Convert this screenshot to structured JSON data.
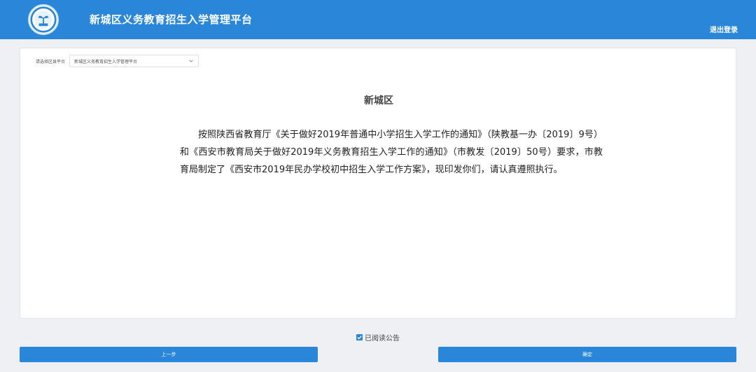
{
  "header": {
    "title": "新城区义务教育招生入学管理平台",
    "logout_label": "退出登录"
  },
  "platform": {
    "label": "请选择区县平台",
    "selected": "新城区义务教育招生入学管理平台"
  },
  "notice": {
    "title": "新城区",
    "body": "按照陕西省教育厅《关于做好2019年普通中小学招生入学工作的通知》（陕教基一办〔2019〕9号）和《西安市教育局关于做好2019年义务教育招生入学工作的通知》（市教发〔2019〕50号）要求，市教育局制定了《西安市2019年民办学校初中招生入学工作方案》，现印发你们，请认真遵照执行。"
  },
  "agree": {
    "label": "已阅读公告",
    "checked": true
  },
  "buttons": {
    "prev_label": "上一步",
    "confirm_label": "确定"
  },
  "colors": {
    "brand": "#2a86d8"
  }
}
